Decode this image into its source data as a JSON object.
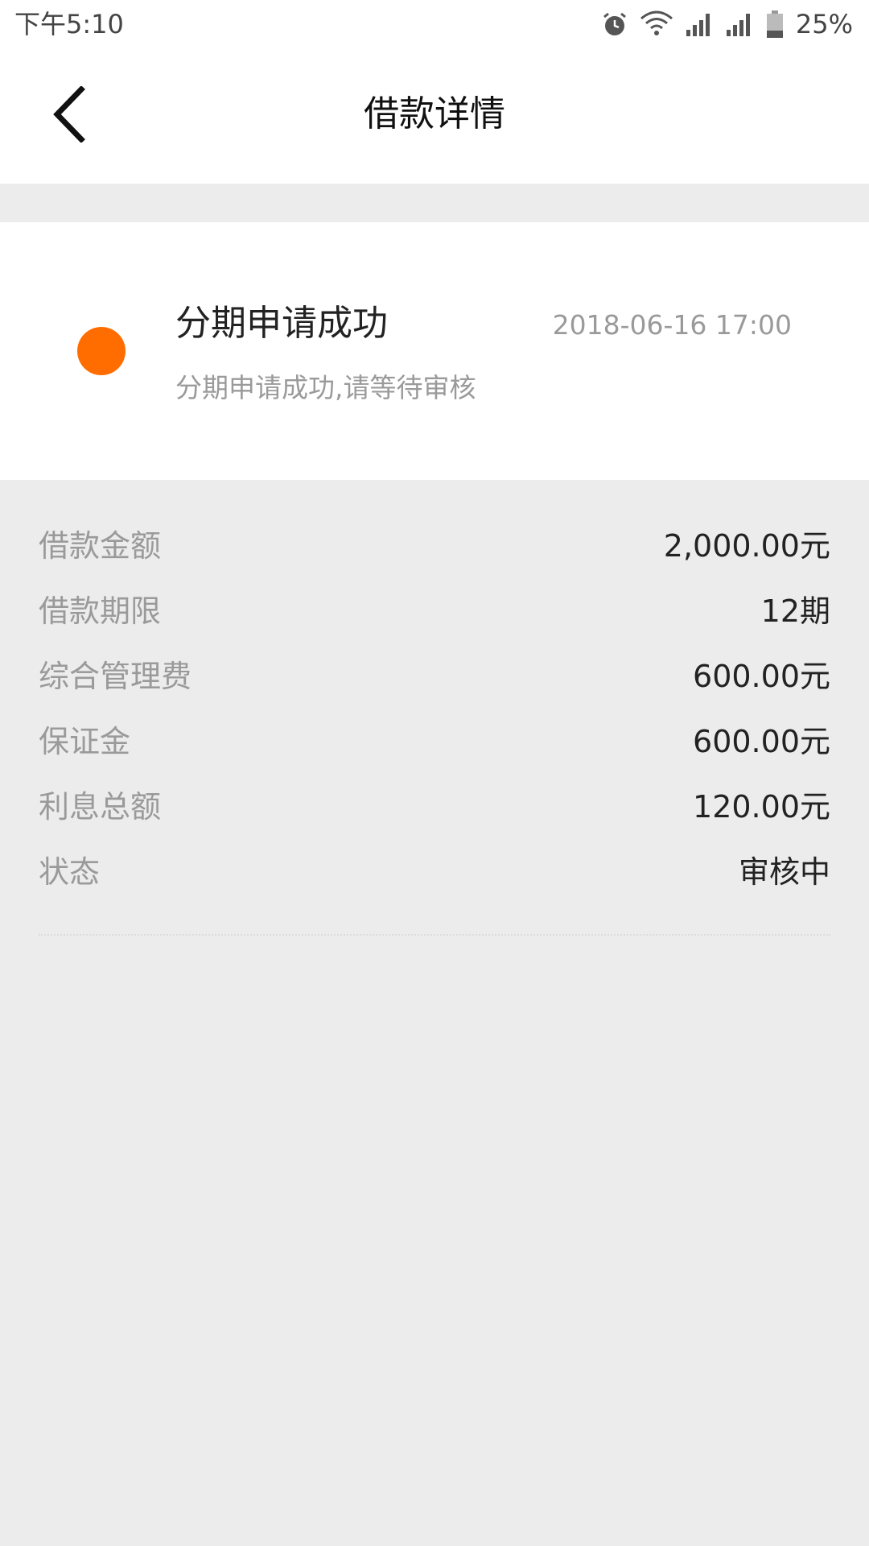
{
  "status_bar": {
    "time": "下午5:10",
    "icons": [
      "alarm-icon",
      "wifi-icon",
      "signal-icon",
      "signal-icon",
      "battery-icon"
    ],
    "battery": "25%"
  },
  "header": {
    "title": "借款详情",
    "back_icon": "chevron-left-icon"
  },
  "status_card": {
    "title": "分期申请成功",
    "time": "2018-06-16 17:00",
    "description": "分期申请成功,请等待审核",
    "dot_color": "#ff6d00"
  },
  "details": [
    {
      "label": "借款金额",
      "value": "2,000.00元"
    },
    {
      "label": "借款期限",
      "value": "12期"
    },
    {
      "label": "综合管理费",
      "value": "600.00元"
    },
    {
      "label": "保证金",
      "value": "600.00元"
    },
    {
      "label": "利息总额",
      "value": "120.00元"
    },
    {
      "label": "状态",
      "value": "审核中"
    }
  ]
}
